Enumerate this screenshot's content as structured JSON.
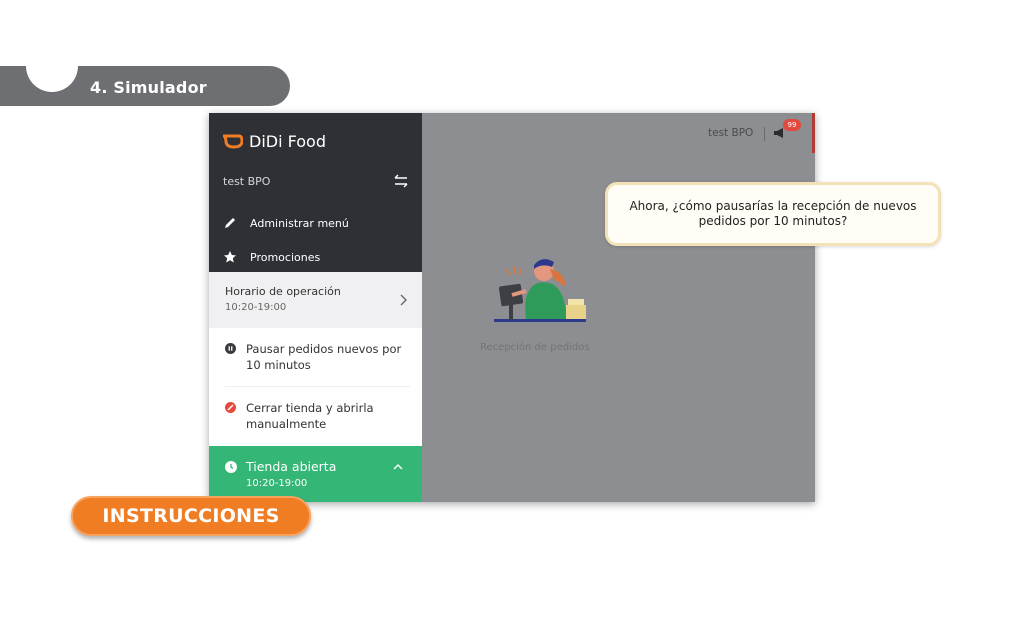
{
  "section": {
    "label": "4. Simulador"
  },
  "sidebar": {
    "brand": "DiDi Food",
    "store_name": "test BPO",
    "menu_items": [
      {
        "label": "Administrar menú",
        "icon": "pencil-icon"
      },
      {
        "label": "Promociones",
        "icon": "star-icon"
      }
    ],
    "hours": {
      "title": "Horario de operación",
      "time": "10:20-19:00"
    },
    "options": [
      {
        "label": "Pausar pedidos nuevos por 10 minutos",
        "icon": "pause-icon"
      },
      {
        "label": "Cerrar tienda y abrirla manualmente",
        "icon": "close-store-icon"
      }
    ],
    "status": {
      "title": "Tienda abierta",
      "time": "10:20-19:00"
    }
  },
  "header": {
    "user": "test BPO",
    "badge_count": "99"
  },
  "main": {
    "reception_label": "Recepción de pedidos"
  },
  "tooltip": {
    "text": "Ahora, ¿cómo pausarías la recepción de nuevos pedidos por 10 minutos?"
  },
  "instructions_button": {
    "label": "INSTRUCCIONES"
  },
  "colors": {
    "brand_orange": "#f07d24",
    "sidebar_dark": "#2e3035",
    "open_green": "#34b676",
    "overlay_gray": "#8d8e92",
    "badge_red": "#e04a3f"
  }
}
